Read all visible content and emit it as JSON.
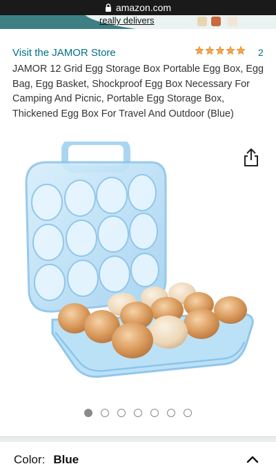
{
  "browser": {
    "url": "amazon.com",
    "lock_icon": "lock-icon"
  },
  "banner": {
    "text": "really delivers"
  },
  "product": {
    "store_link": "Visit the JAMOR Store",
    "rating": 5,
    "rating_count": "2",
    "title": "JAMOR 12 Grid Egg Storage Box Portable Egg Box, Egg Bag, Egg Basket, Shockproof Egg Box Necessary For Camping And Picnic, Portable Egg Storage Box, Thickened Egg Box For Travel And Outdoor (Blue)",
    "image_count": 7,
    "active_image": 1
  },
  "variation": {
    "label": "Color:",
    "value": "Blue"
  },
  "colors": {
    "link": "#007185",
    "star": "#f3a847",
    "box_blue": "#9fd0f0"
  }
}
